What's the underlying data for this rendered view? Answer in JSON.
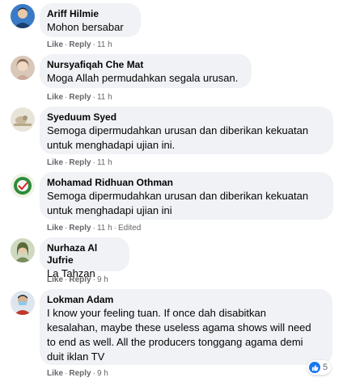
{
  "comments": [
    {
      "name": "Ariff Hilmie",
      "text": [
        "Mohon bersabar"
      ],
      "like": "Like",
      "reply": "Reply",
      "time": "11 h",
      "edited": ""
    },
    {
      "name": "Nursyafiqah Che Mat",
      "text": [
        "Moga Allah permudahkan segala urusan."
      ],
      "like": "Like",
      "reply": "Reply",
      "time": "11 h",
      "edited": ""
    },
    {
      "name": "Syeduum Syed",
      "text": [
        "Semoga dipermudahkan urusan dan diberikan kekuatan",
        "untuk menghadapi ujian ini."
      ],
      "like": "Like",
      "reply": "Reply",
      "time": "11 h",
      "edited": ""
    },
    {
      "name": "Mohamad Ridhuan Othman",
      "text": [
        "Semoga dipermudahkan urusan dan diberikan kekuatan",
        "untuk menghadapi ujian ini"
      ],
      "like": "Like",
      "reply": "Reply",
      "time": "11 h",
      "edited": "Edited"
    },
    {
      "name": "Nurhaza Al Jufrie",
      "text": [
        "La Tahzan"
      ],
      "like": "Like",
      "reply": "Reply",
      "time": "9 h",
      "edited": ""
    },
    {
      "name": "Lokman Adam",
      "text": [
        "I know your feeling tuan. If once dah disabitkan",
        "kesalahan, maybe these useless agama shows will need",
        "to end as well. All the producers tonggang agama demi",
        "duit iklan TV"
      ],
      "like": "Like",
      "reply": "Reply",
      "time": "9 h",
      "edited": ""
    }
  ],
  "reactions": {
    "icon": "like-icon",
    "count": "5"
  },
  "colors": {
    "bubble": "#f0f2f5",
    "meta": "#65676b",
    "like_blue": "#1877f2"
  }
}
